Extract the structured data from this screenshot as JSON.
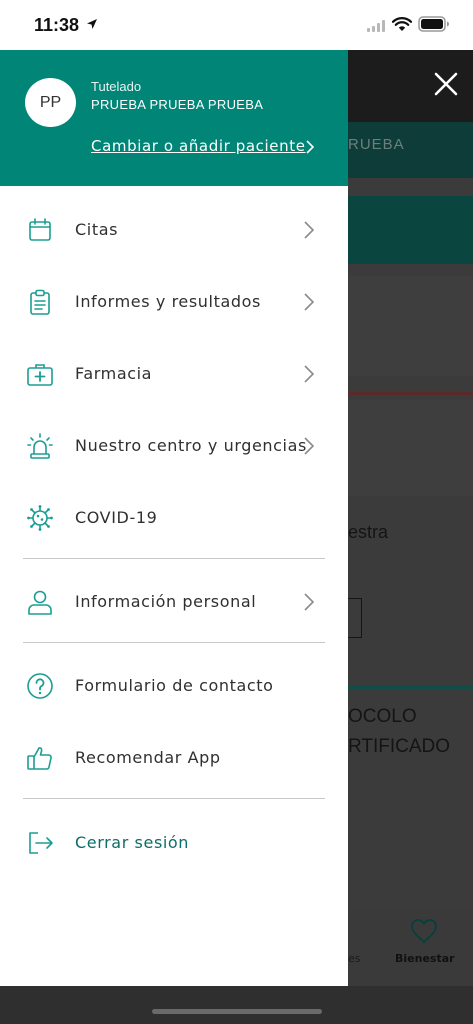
{
  "status_bar": {
    "time": "11:38"
  },
  "background": {
    "teal_bar_text": "RUEBA",
    "text_fragment": "estra",
    "card_line1": "OCOLO",
    "card_line2": "RTIFICADO",
    "tab_partial": "es",
    "tab_bienestar": "Bienestar"
  },
  "drawer": {
    "header": {
      "avatar_initials": "PP",
      "role": "Tutelado",
      "patient_name": "PRUEBA PRUEBA PRUEBA",
      "change_link": "Cambiar o añadir paciente"
    },
    "items": [
      {
        "label": "Citas",
        "icon": "calendar-icon"
      },
      {
        "label": "Informes y resultados",
        "icon": "clipboard-icon"
      },
      {
        "label": "Farmacia",
        "icon": "medical-kit-icon"
      },
      {
        "label": "Nuestro centro y urgencias",
        "icon": "siren-icon"
      },
      {
        "label": "COVID-19",
        "icon": "virus-icon"
      },
      {
        "label": "Información personal",
        "icon": "user-icon"
      },
      {
        "label": "Formulario de contacto",
        "icon": "question-icon"
      },
      {
        "label": "Recomendar App",
        "icon": "thumbs-up-icon"
      },
      {
        "label": "Cerrar sesión",
        "icon": "logout-icon"
      }
    ]
  },
  "colors": {
    "primary": "#008577",
    "logout_text": "#0b6e68",
    "icon": "#1b9e92"
  }
}
